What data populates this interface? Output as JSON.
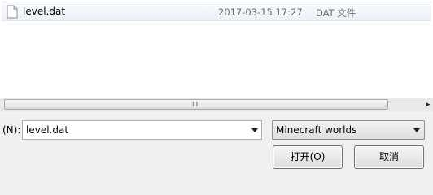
{
  "file_list": {
    "rows": [
      {
        "name": "level.dat",
        "date": "2017-03-15 17:27",
        "type": "DAT 文件",
        "icon": "document-icon"
      }
    ]
  },
  "scrollbar": {
    "grip": "III",
    "right_arrow": "▸"
  },
  "filename": {
    "label": "(N):",
    "value": "level.dat"
  },
  "filter": {
    "selected": "Minecraft worlds"
  },
  "buttons": {
    "open": "打开(O)",
    "cancel": "取消"
  }
}
